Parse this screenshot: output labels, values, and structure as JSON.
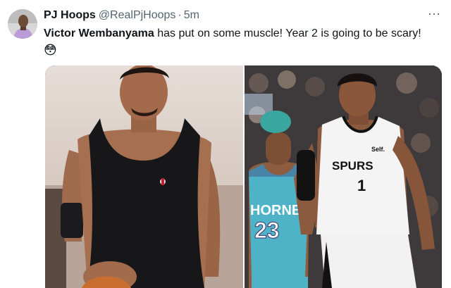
{
  "tweet": {
    "author_name": "PJ Hoops",
    "author_handle": "@RealPjHoops",
    "separator": "·",
    "time": "5m",
    "more_label": "···",
    "text_bold": "Victor Wembanyama",
    "text_rest": " has put on some muscle! Year 2 is going to be scary!",
    "emoji": "😳"
  },
  "media": {
    "right_photo": {
      "jersey_left_team": "HORNETS",
      "jersey_left_number": "23",
      "jersey_right_team": "SPURS",
      "jersey_right_number": "1",
      "sponsor": "Self."
    }
  }
}
